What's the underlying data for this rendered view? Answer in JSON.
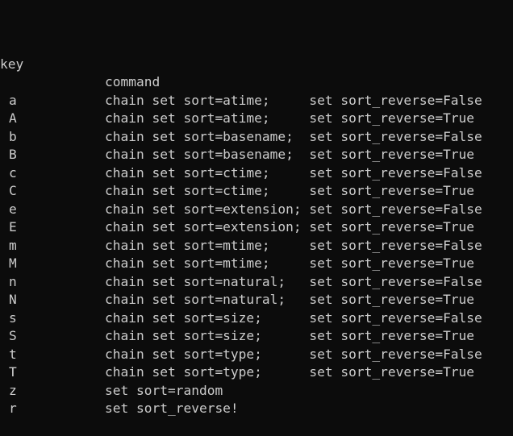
{
  "header": {
    "key": "key",
    "command": "command"
  },
  "rows": [
    {
      "key": "a",
      "command": "chain set sort=atime;     set sort_reverse=False"
    },
    {
      "key": "A",
      "command": "chain set sort=atime;     set sort_reverse=True"
    },
    {
      "key": "b",
      "command": "chain set sort=basename;  set sort_reverse=False"
    },
    {
      "key": "B",
      "command": "chain set sort=basename;  set sort_reverse=True"
    },
    {
      "key": "c",
      "command": "chain set sort=ctime;     set sort_reverse=False"
    },
    {
      "key": "C",
      "command": "chain set sort=ctime;     set sort_reverse=True"
    },
    {
      "key": "e",
      "command": "chain set sort=extension; set sort_reverse=False"
    },
    {
      "key": "E",
      "command": "chain set sort=extension; set sort_reverse=True"
    },
    {
      "key": "m",
      "command": "chain set sort=mtime;     set sort_reverse=False"
    },
    {
      "key": "M",
      "command": "chain set sort=mtime;     set sort_reverse=True"
    },
    {
      "key": "n",
      "command": "chain set sort=natural;   set sort_reverse=False"
    },
    {
      "key": "N",
      "command": "chain set sort=natural;   set sort_reverse=True"
    },
    {
      "key": "s",
      "command": "chain set sort=size;      set sort_reverse=False"
    },
    {
      "key": "S",
      "command": "chain set sort=size;      set sort_reverse=True"
    },
    {
      "key": "t",
      "command": "chain set sort=type;      set sort_reverse=False"
    },
    {
      "key": "T",
      "command": "chain set sort=type;      set sort_reverse=True"
    },
    {
      "key": "z",
      "command": "set sort=random"
    },
    {
      "key": "r",
      "command": "set sort_reverse!"
    }
  ]
}
